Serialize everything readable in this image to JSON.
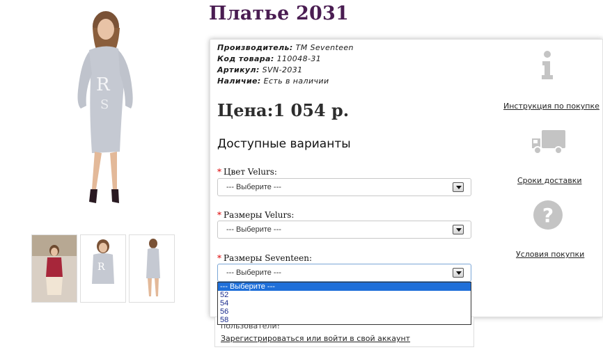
{
  "product": {
    "title": "Платье 2031",
    "price": "Цена:1 054 р.",
    "info": [
      {
        "label": "Производитель:",
        "value": " TM Seventeen"
      },
      {
        "label": "Код товара:",
        "value": " 110048-31"
      },
      {
        "label": "Артикул:",
        "value": " SVN-2031"
      },
      {
        "label": "Наличие:",
        "value": " Есть в наличии"
      }
    ]
  },
  "variants": {
    "title": "Доступные варианты",
    "required_mark": "*",
    "options": [
      {
        "label": "Цвет Velurs:",
        "selected": "--- Выберите ---"
      },
      {
        "label": "Размеры Velurs:",
        "selected": "--- Выберите ---"
      },
      {
        "label": "Размеры Seventeen:",
        "selected": "--- Выберите ---"
      }
    ],
    "dropdown_items": [
      "--- Выберите ---",
      "52",
      "54",
      "56",
      "58"
    ]
  },
  "sidebar": {
    "links": [
      {
        "label": "Инструкция по покупке",
        "icon": "info-icon"
      },
      {
        "label": "Сроки доставки",
        "icon": "truck-icon"
      },
      {
        "label": "Условия покупки",
        "icon": "question-icon"
      }
    ]
  },
  "register": {
    "text": "пользователи!",
    "link": "Зарегистрироваться или войти в свой аккаунт"
  },
  "colors": {
    "title": "#4a1d52",
    "dress": "#c5c9d2",
    "dropdown_highlight": "#1e6fd9",
    "icon_gray": "#c4c4c4"
  }
}
